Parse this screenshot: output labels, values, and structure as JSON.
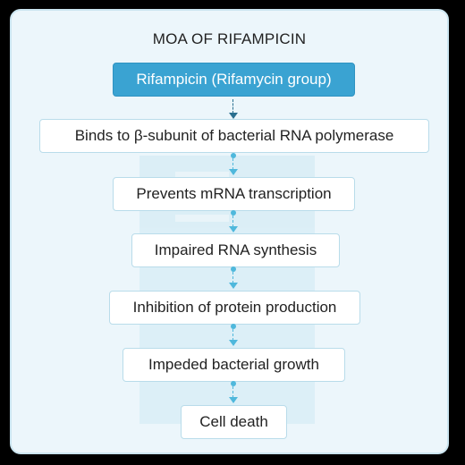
{
  "title": "MOA OF RIFAMPICIN",
  "steps": [
    "Rifampicin (Rifamycin group)",
    "Binds to β-subunit of bacterial RNA polymerase",
    "Prevents mRNA transcription",
    "Impaired RNA synthesis",
    "Inhibition of protein production",
    "Impeded bacterial growth",
    "Cell death"
  ],
  "colors": {
    "page_background": "#000000",
    "card_background": "#ecf6fb",
    "highlight_box": "#3aa3d2",
    "connector": "#4fb8dc",
    "box_border": "#b9dcea"
  }
}
